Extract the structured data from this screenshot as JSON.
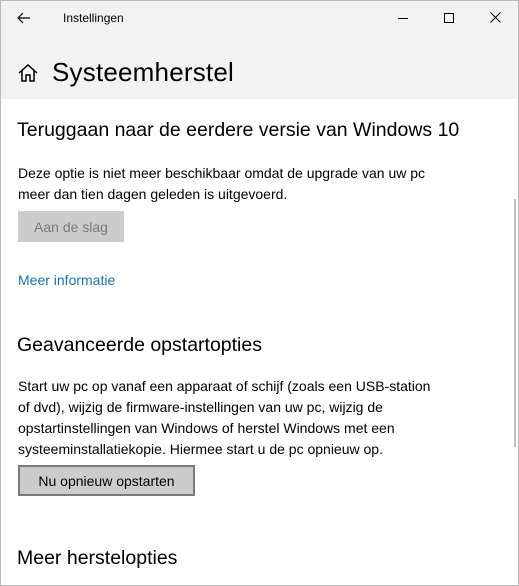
{
  "window": {
    "app_title": "Instellingen"
  },
  "header": {
    "page_title": "Systeemherstel"
  },
  "sections": {
    "goback": {
      "title": "Teruggaan naar de eerdere versie van Windows 10",
      "description_line1": "Deze optie is niet meer beschikbaar omdat de upgrade van uw pc",
      "description_line2": "meer dan tien dagen geleden is uitgevoerd.",
      "button_label": "Aan de slag",
      "link_label": "Meer informatie"
    },
    "advanced": {
      "title": "Geavanceerde opstartopties",
      "description_line1": "Start uw pc op vanaf een apparaat of schijf (zoals een USB-station",
      "description_line2": "of dvd), wijzig de firmware-instellingen van uw pc, wijzig de",
      "description_line3": "opstartinstellingen van Windows of herstel Windows met een",
      "description_line4": "systeeminstallatiekopie. Hiermee start u de pc opnieuw op.",
      "button_label": "Nu opnieuw opstarten"
    },
    "more": {
      "title": "Meer herstelopties"
    }
  },
  "icons": {
    "back": "back-arrow-icon",
    "home": "home-icon",
    "minimize": "minimize-icon",
    "maximize": "maximize-icon",
    "close": "close-icon"
  },
  "colors": {
    "titlebar_bg": "#f2f2f2",
    "link": "#1a73a8",
    "button_bg": "#cccccc",
    "disabled_text": "#7a7a7a"
  }
}
